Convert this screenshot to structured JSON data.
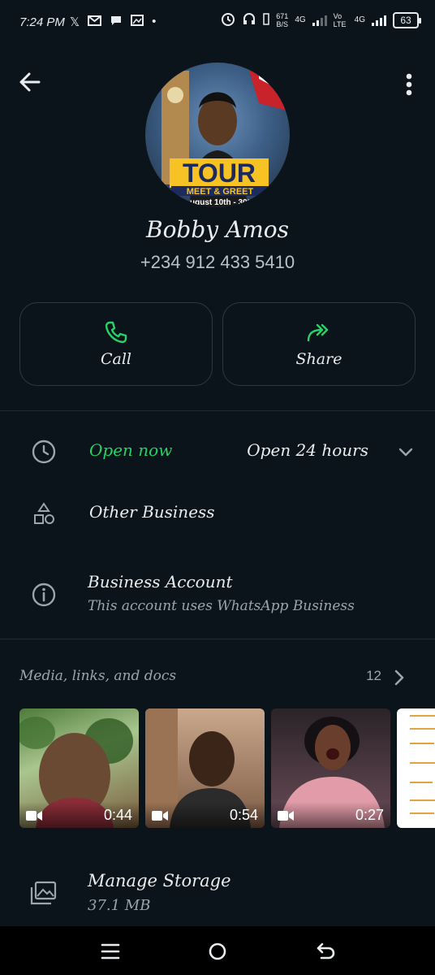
{
  "status_bar": {
    "time": "7:24 PM",
    "notification_icons": [
      "x-icon",
      "gmail-icon",
      "chat-bubble-icon",
      "image-icon",
      "dot-icon"
    ],
    "net_speed_value": "671",
    "net_speed_unit": "B/S",
    "network_1": "4G",
    "volte": "Vo LTE",
    "network_2": "4G",
    "battery": "63"
  },
  "header": {
    "back_icon": "arrow-left-icon",
    "menu_icon": "more-vertical-icon"
  },
  "profile": {
    "name": "Bobby Amos",
    "phone": "+234 912 433 5410",
    "avatar_text_1": "TOUR",
    "avatar_text_2": "MEET & GREET",
    "avatar_text_3": "ugust 10th - 30t"
  },
  "actions": {
    "call_label": "Call",
    "share_label": "Share",
    "accent": "#25d366"
  },
  "hours": {
    "status": "Open now",
    "detail": "Open 24 hours"
  },
  "other_business": {
    "label": "Other Business"
  },
  "business_account": {
    "title": "Business Account",
    "subtitle": "This account uses WhatsApp Business"
  },
  "media": {
    "title": "Media, links, and docs",
    "count": "12",
    "items": [
      {
        "type": "video",
        "duration": "0:44"
      },
      {
        "type": "video",
        "duration": "0:54"
      },
      {
        "type": "video",
        "duration": "0:27"
      },
      {
        "type": "document"
      }
    ]
  },
  "storage": {
    "title": "Manage Storage",
    "size": "37.1 MB"
  },
  "navbar": {
    "icons": [
      "menu-icon",
      "home-circle-icon",
      "back-nav-icon"
    ]
  }
}
